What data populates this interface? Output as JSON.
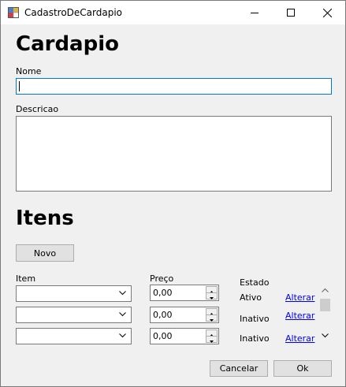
{
  "window": {
    "title": "CadastroDeCardapio"
  },
  "header": {
    "title": "Cardapio"
  },
  "form": {
    "nome_label": "Nome",
    "nome_value": "",
    "descricao_label": "Descricao",
    "descricao_value": ""
  },
  "itens": {
    "title": "Itens",
    "novo_label": "Novo",
    "col_item": "Item",
    "col_preco": "Preço",
    "col_estado": "Estado",
    "rows": [
      {
        "item": "",
        "preco": "0,00",
        "estado": "Ativo",
        "alterar": "Alterar"
      },
      {
        "item": "",
        "preco": "0,00",
        "estado": "Inativo",
        "alterar": "Alterar"
      },
      {
        "item": "",
        "preco": "0,00",
        "estado": "Inativo",
        "alterar": "Alterar"
      }
    ]
  },
  "footer": {
    "cancelar_label": "Cancelar",
    "ok_label": "Ok"
  },
  "colors": {
    "accent_focus": "#0078d7",
    "link": "#0000ff",
    "window_bg": "#f0f0f0"
  },
  "icons": [
    "app-icon",
    "minimize-icon",
    "maximize-icon",
    "close-icon",
    "chevron-down-icon",
    "spin-up-icon",
    "spin-down-icon",
    "scroll-up-icon",
    "scroll-down-icon"
  ]
}
